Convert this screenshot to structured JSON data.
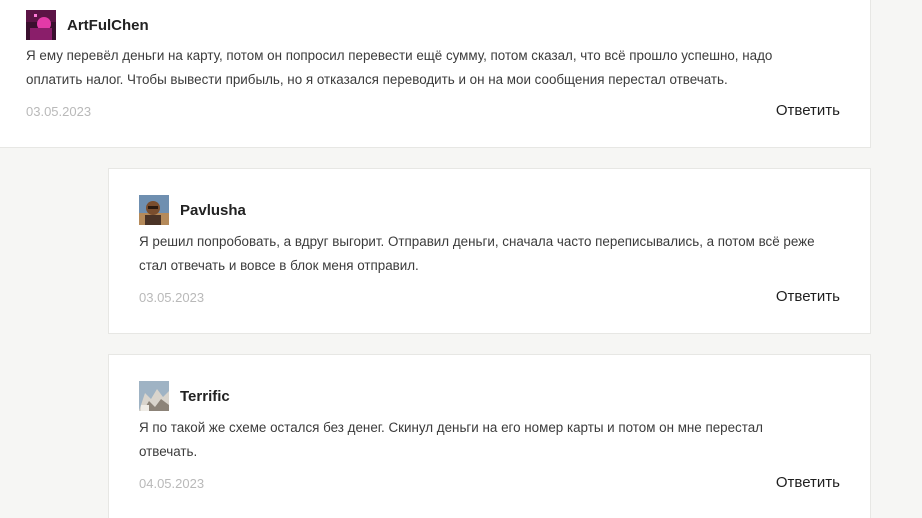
{
  "comments": [
    {
      "author": "ArtFulChen",
      "avatar": "avatar-pink-neon",
      "text": "Я ему перевёл деньги на карту, потом он попросил перевести ещё сумму, потом сказал, что всё прошло успешно, надо оплатить налог. Чтобы вывести прибыль, но я отказался переводить и он на мои сообщения перестал отвечать.",
      "date": "03.05.2023",
      "reply_label": "Ответить"
    },
    {
      "author": "Pavlusha",
      "avatar": "avatar-person-photo",
      "text": "Я решил попробовать, а вдруг выгорит. Отправил деньги, сначала часто переписывались, а потом всё реже стал отвечать и вовсе в блок меня отправил.",
      "date": "03.05.2023",
      "reply_label": "Ответить"
    },
    {
      "author": "Terrific",
      "avatar": "avatar-rocks-photo",
      "text": "Я по такой же схеме остался без денег. Скинул деньги на его номер карты и потом он мне перестал отвечать.",
      "date": "04.05.2023",
      "reply_label": "Ответить"
    }
  ]
}
